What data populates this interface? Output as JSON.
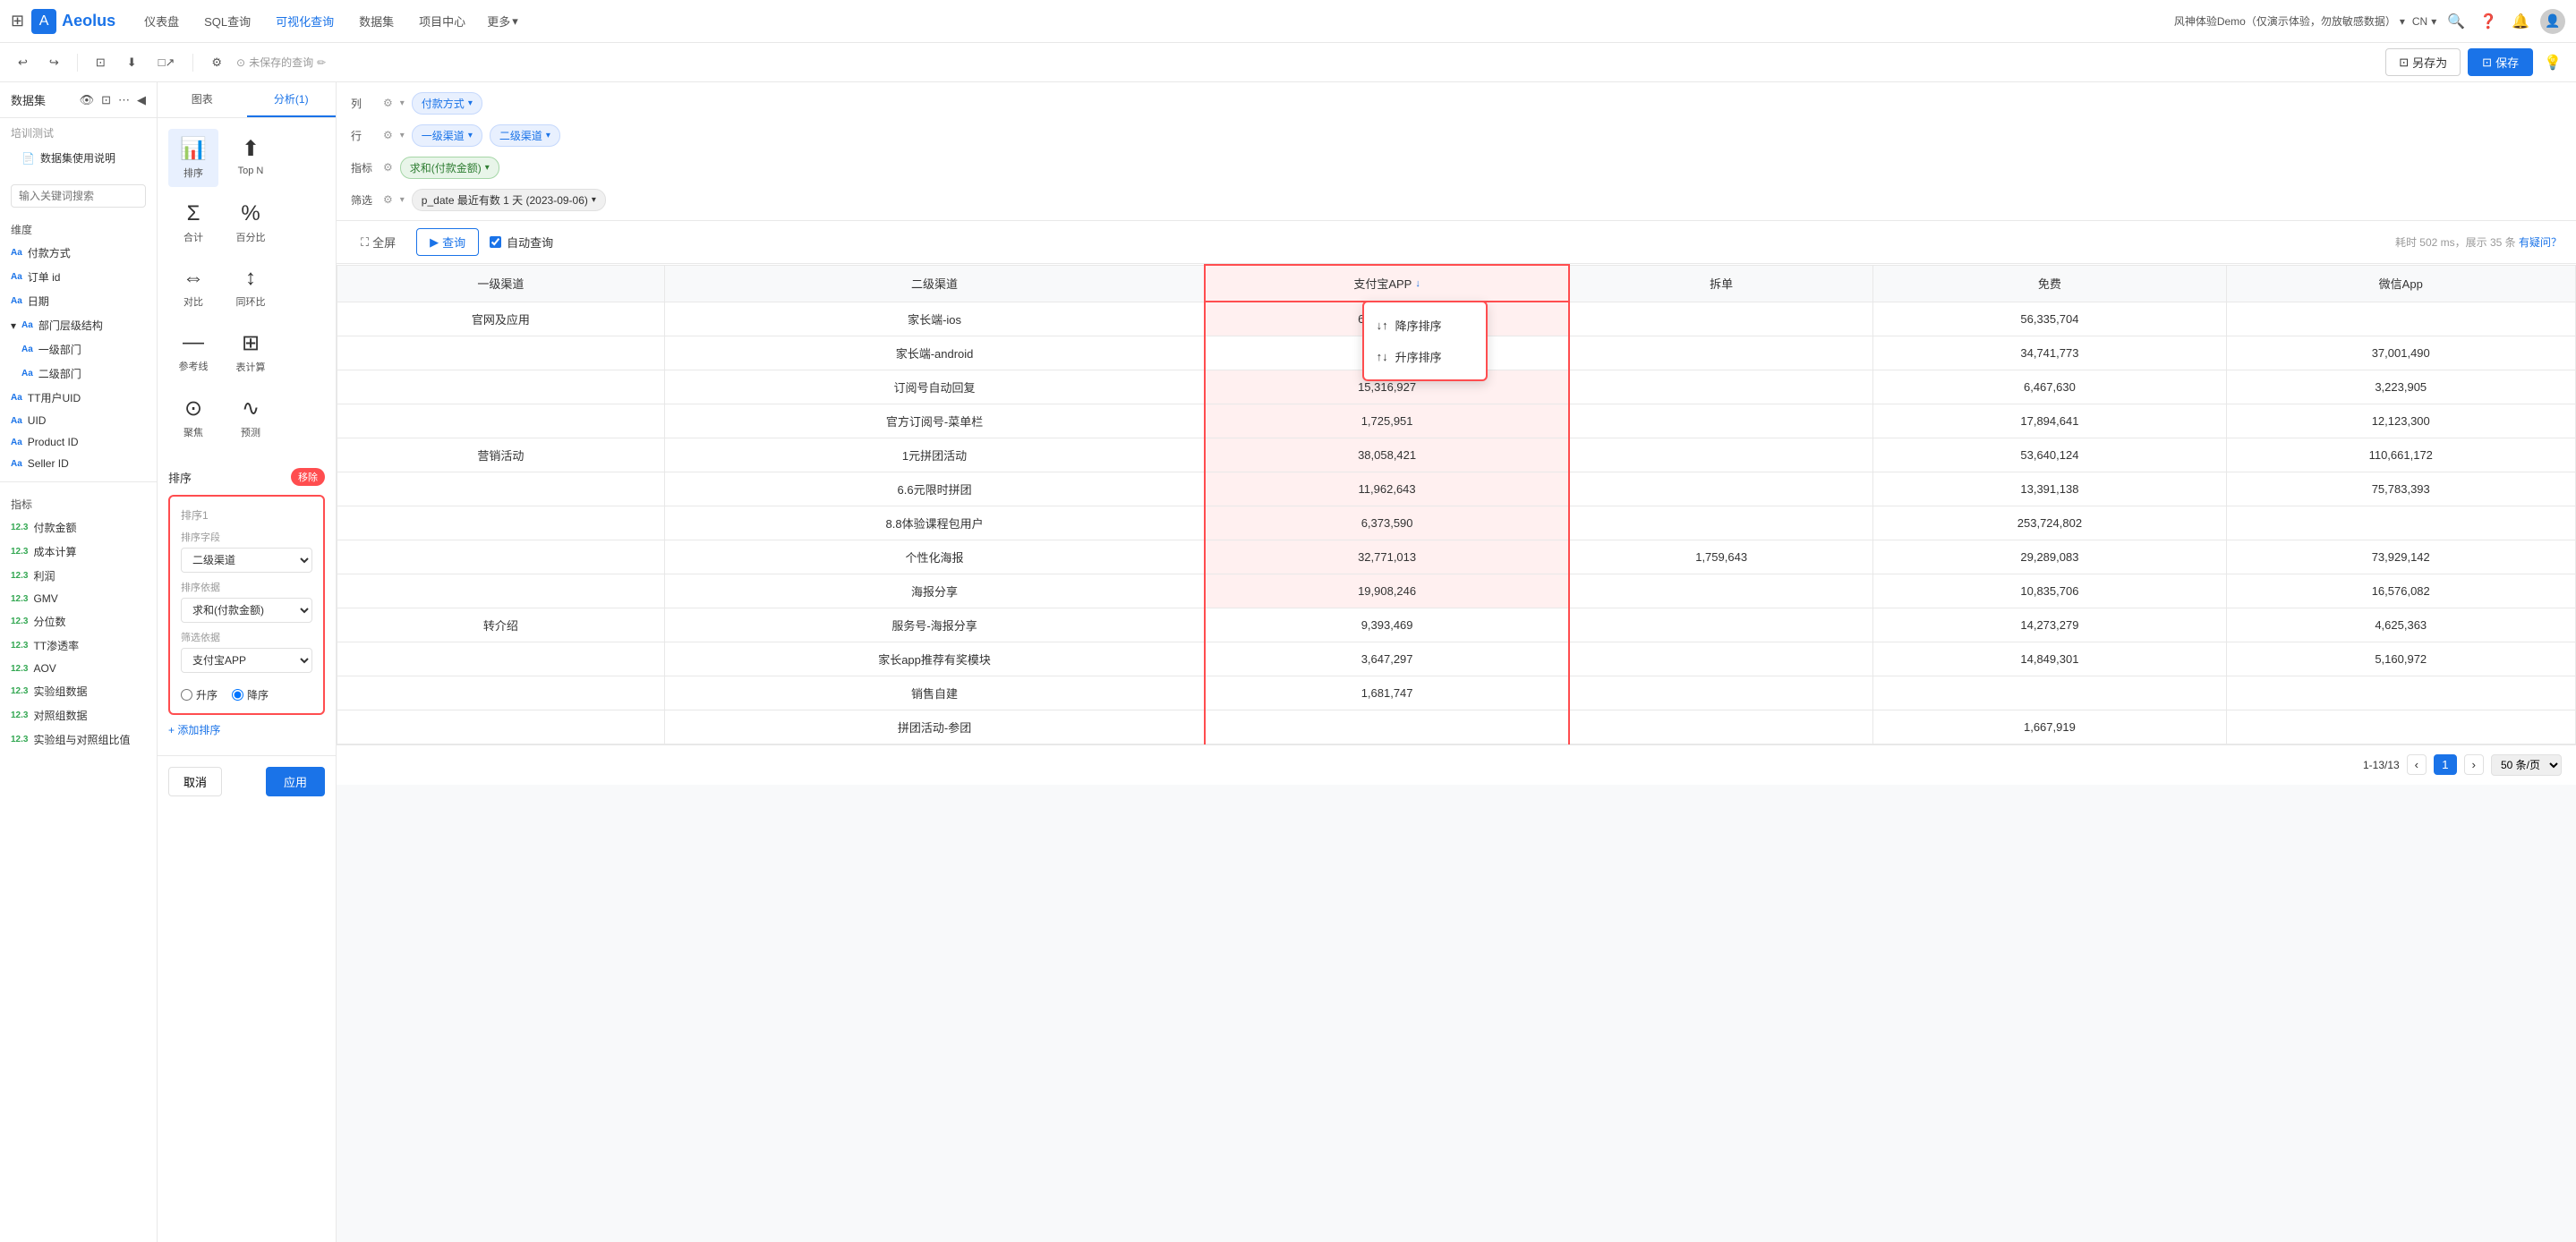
{
  "topNav": {
    "logoText": "Aeolus",
    "navItems": [
      "仪表盘",
      "SQL查询",
      "可视化查询",
      "数据集",
      "项目中心",
      "更多"
    ],
    "moreLabel": "更多",
    "userDemo": "风神体验Demo（仅演示体验，勿放敏感数据）",
    "langLabel": "CN"
  },
  "toolbar": {
    "undoLabel": "↩",
    "redoLabel": "↪",
    "settingsLabel": "⚙",
    "unsavedLabel": "未保存的查询",
    "saveAsLabel": "另存为",
    "saveLabel": "保存"
  },
  "sidebar": {
    "title": "数据集",
    "searchPlaceholder": "输入关键词搜索",
    "sectionLabel": "培训测试",
    "datasetLabel": "数据集使用说明",
    "categories": {
      "dimensions": "维度",
      "metrics": "指标"
    },
    "dimensionItems": [
      {
        "label": "付款方式",
        "type": "text"
      },
      {
        "label": "订单 id",
        "type": "text"
      },
      {
        "label": "日期",
        "type": "text"
      },
      {
        "label": "部门层级结构",
        "type": "text",
        "isGroup": true
      },
      {
        "label": "一级部门",
        "type": "text",
        "indent": true
      },
      {
        "label": "二级部门",
        "type": "text",
        "indent": true
      },
      {
        "label": "TT用户UID",
        "type": "text"
      },
      {
        "label": "UID",
        "type": "text"
      },
      {
        "label": "Product ID",
        "type": "text"
      },
      {
        "label": "Seller ID",
        "type": "text"
      }
    ],
    "metricItems": [
      {
        "label": "付款金额",
        "type": "num"
      },
      {
        "label": "成本计算",
        "type": "num"
      },
      {
        "label": "利润",
        "type": "num"
      },
      {
        "label": "GMV",
        "type": "num"
      },
      {
        "label": "分位数",
        "type": "num"
      },
      {
        "label": "TT渗透率",
        "type": "num"
      },
      {
        "label": "AOV",
        "type": "num"
      },
      {
        "label": "实验组数据",
        "type": "num"
      },
      {
        "label": "对照组数据",
        "type": "num"
      },
      {
        "label": "实验组与对照组比值",
        "type": "num"
      }
    ]
  },
  "middlePanel": {
    "tabs": [
      "图表",
      "分析(1)"
    ],
    "activeTab": 1,
    "chartOptions": [
      {
        "label": "排序",
        "icon": "≡↑"
      },
      {
        "label": "Top N",
        "icon": "⬆N"
      },
      {
        "label": "合计",
        "icon": "Σ"
      },
      {
        "label": "百分比",
        "icon": "%"
      },
      {
        "label": "对比",
        "icon": "⇔"
      },
      {
        "label": "同环比",
        "icon": "↕↕"
      },
      {
        "label": "参考线",
        "icon": "—|"
      },
      {
        "label": "表计算",
        "icon": "⊞"
      },
      {
        "label": "聚焦",
        "icon": "⊙"
      },
      {
        "label": "预测",
        "icon": "∿"
      }
    ],
    "sortSection": {
      "title": "排序",
      "removeLabel": "移除",
      "sortBox": {
        "title": "排序1",
        "fieldLabel": "排序依据",
        "fieldValue": "二级渠道",
        "basisLabel": "排序依据",
        "basisValue": "求和(付款金额)",
        "filterLabel": "筛选依据",
        "filterValue": "支付宝APP",
        "orderAsc": "升序",
        "orderDesc": "降序",
        "selectedOrder": "desc"
      },
      "addSortLabel": "+ 添加排序"
    },
    "cancelLabel": "取消",
    "applyLabel": "应用"
  },
  "configBar": {
    "colLabel": "列",
    "rowLabel": "行",
    "metricLabel": "指标",
    "filterLabel": "筛选",
    "colChip": "付款方式",
    "rowChips": [
      "一级渠道",
      "二级渠道"
    ],
    "metricChip": "求和(付款金额)",
    "filterChip": "p_date 最近有数 1 天 (2023-09-06)"
  },
  "queryBar": {
    "fullscreenLabel": "全屏",
    "queryLabel": "查询",
    "autoQueryLabel": "自动查询",
    "timeInfo": "耗时 502 ms，展示 35 条",
    "helpLink": "有疑问？"
  },
  "table": {
    "headers": [
      "一级渠道",
      "二级渠道",
      "支付宝APP",
      "拆单",
      "免费",
      "微信App"
    ],
    "sortHeader": "支付宝APP",
    "sortDropdown": [
      "降序排序",
      "升序排序"
    ],
    "rows": [
      {
        "channel1": "官网及应用",
        "channel2": "家长端-ios",
        "zhifubaoApp": "64,422,509",
        "chai": "",
        "mianfei": "56,335,704",
        "weixinApp": ""
      },
      {
        "channel1": "",
        "channel2": "家长端-android",
        "zhifubaoApp": "",
        "chai": "",
        "mianfei": "34,741,773",
        "weixinApp": "37,001,490"
      },
      {
        "channel1": "",
        "channel2": "订阅号自动回复",
        "zhifubaoApp": "15,316,927",
        "chai": "",
        "mianfei": "6,467,630",
        "weixinApp": "3,223,905"
      },
      {
        "channel1": "",
        "channel2": "官方订阅号-菜单栏",
        "zhifubaoApp": "1,725,951",
        "chai": "",
        "mianfei": "17,894,641",
        "weixinApp": "12,123,300"
      },
      {
        "channel1": "营销活动",
        "channel2": "1元拼团活动",
        "zhifubaoApp": "38,058,421",
        "chai": "",
        "mianfei": "53,640,124",
        "weixinApp": "110,661,172"
      },
      {
        "channel1": "",
        "channel2": "6.6元限时拼团",
        "zhifubaoApp": "11,962,643",
        "chai": "",
        "mianfei": "13,391,138",
        "weixinApp": "75,783,393"
      },
      {
        "channel1": "",
        "channel2": "8.8体验课程包用户",
        "zhifubaoApp": "6,373,590",
        "chai": "",
        "mianfei": "253,724,802",
        "weixinApp": ""
      },
      {
        "channel1": "",
        "channel2": "个性化海报",
        "zhifubaoApp": "32,771,013",
        "chai": "1,759,643",
        "mianfei": "29,289,083",
        "weixinApp": "73,929,142"
      },
      {
        "channel1": "",
        "channel2": "海报分享",
        "zhifubaoApp": "19,908,246",
        "chai": "",
        "mianfei": "10,835,706",
        "weixinApp": "16,576,082"
      },
      {
        "channel1": "转介绍",
        "channel2": "服务号-海报分享",
        "zhifubaoApp": "9,393,469",
        "chai": "",
        "mianfei": "14,273,279",
        "weixinApp": "4,625,363"
      },
      {
        "channel1": "",
        "channel2": "家长app推荐有奖模块",
        "zhifubaoApp": "3,647,297",
        "chai": "",
        "mianfei": "14,849,301",
        "weixinApp": "5,160,972"
      },
      {
        "channel1": "",
        "channel2": "销售自建",
        "zhifubaoApp": "1,681,747",
        "chai": "",
        "mianfei": "",
        "weixinApp": ""
      },
      {
        "channel1": "",
        "channel2": "拼团活动-参团",
        "zhifubaoApp": "",
        "chai": "",
        "mianfei": "1,667,919",
        "weixinApp": ""
      }
    ]
  },
  "pagination": {
    "rangeLabel": "1-13/13",
    "prevLabel": "‹",
    "nextLabel": "›",
    "currentPage": "1",
    "pageSizeLabel": "50 条/页"
  }
}
